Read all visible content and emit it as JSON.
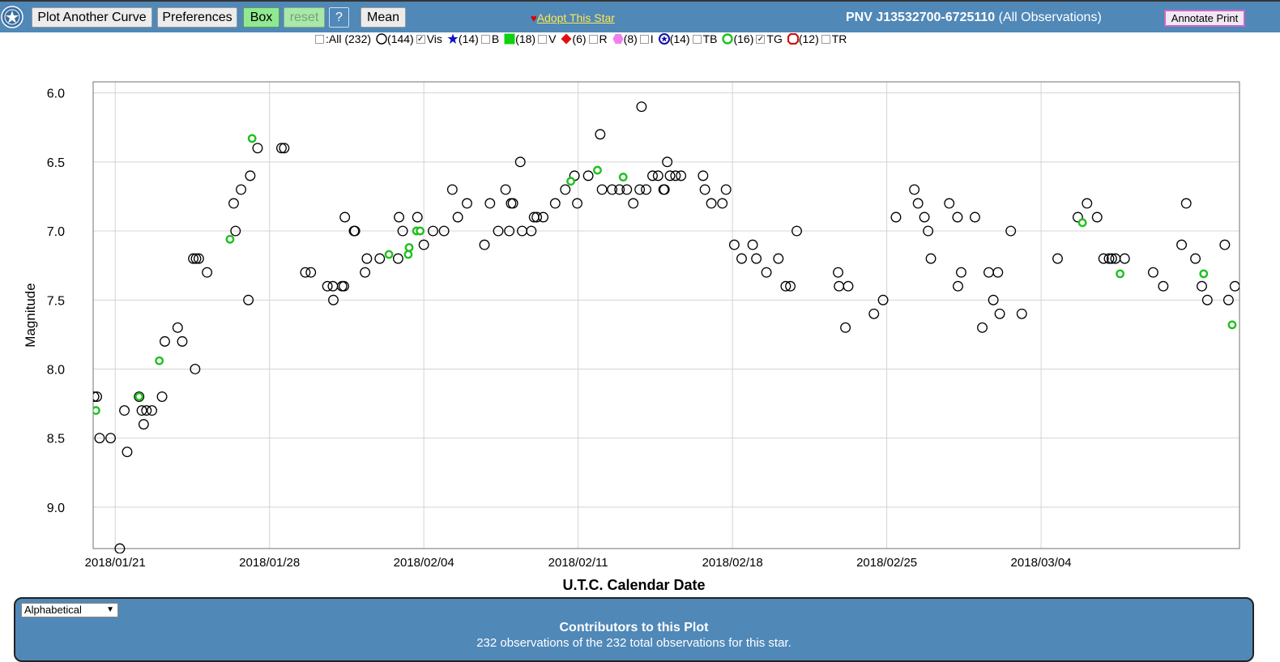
{
  "toolbar": {
    "plot_another": "Plot Another Curve",
    "preferences": "Preferences",
    "box": "Box",
    "reset": "reset",
    "help": "?",
    "mean": "Mean",
    "adopt_heart": "♥",
    "adopt_link": "Adopt This Star",
    "star_name": "PNV J13532700-6725110",
    "star_scope": "(All Observations)",
    "annotate": "Annotate Print"
  },
  "legend": [
    {
      "checkbox": false,
      "count": "",
      "label": ":All (232)",
      "icon": "none",
      "color": ""
    },
    {
      "checkbox": true,
      "count": "(144)",
      "label": "Vis",
      "icon": "open-circle-icon",
      "color": "#000000"
    },
    {
      "checkbox": false,
      "count": "(14)",
      "label": "B",
      "icon": "star-icon",
      "color": "#1010d0"
    },
    {
      "checkbox": false,
      "count": "(18)",
      "label": "V",
      "icon": "square-icon",
      "color": "#10d010"
    },
    {
      "checkbox": false,
      "count": "(6)",
      "label": "R",
      "icon": "diamond-icon",
      "color": "#e01010"
    },
    {
      "checkbox": false,
      "count": "(8)",
      "label": "I",
      "icon": "hexagon-icon",
      "color": "#f080f0"
    },
    {
      "checkbox": false,
      "count": "(14)",
      "label": "TB",
      "icon": "ring-star-icon",
      "color": "#1010a0"
    },
    {
      "checkbox": true,
      "count": "(16)",
      "label": "TG",
      "icon": "green-ring-icon",
      "color": "#20c020"
    },
    {
      "checkbox": false,
      "count": "(12)",
      "label": "TR",
      "icon": "red-octagon-icon",
      "color": "#d01010"
    }
  ],
  "chart_data": {
    "type": "scatter",
    "ylabel": "Magnitude",
    "xlabel": "U.T.C. Calendar Date",
    "x_unit": "date (UTC)",
    "xlim": [
      "2018-01-20T00:00",
      "2018-03-13T00:00"
    ],
    "ylim": [
      5.92,
      9.3
    ],
    "y_inverted": true,
    "y_ticks": [
      "6.0",
      "6.5",
      "7.0",
      "7.5",
      "8.0",
      "8.5",
      "9.0"
    ],
    "x_ticks": [
      {
        "date": "2018-01-21",
        "label": "2018/01/21"
      },
      {
        "date": "2018-01-28",
        "label": "2018/01/28"
      },
      {
        "date": "2018-02-04",
        "label": "2018/02/04"
      },
      {
        "date": "2018-02-11",
        "label": "2018/02/11"
      },
      {
        "date": "2018-02-18",
        "label": "2018/02/18"
      },
      {
        "date": "2018-02-25",
        "label": "2018/02/25"
      },
      {
        "date": "2018-03-04",
        "label": "2018/03/04"
      }
    ],
    "grid": true,
    "series": [
      {
        "name": "Vis",
        "marker": "open-circle",
        "color": "#000000",
        "points": [
          {
            "x": "2018-01-20T01:00",
            "y": 8.2
          },
          {
            "x": "2018-01-20T04:00",
            "y": 8.2
          },
          {
            "x": "2018-01-20T07:00",
            "y": 8.5
          },
          {
            "x": "2018-01-20T19:00",
            "y": 8.5
          },
          {
            "x": "2018-01-21T05:00",
            "y": 9.3
          },
          {
            "x": "2018-01-21T10:00",
            "y": 8.3
          },
          {
            "x": "2018-01-21T13:00",
            "y": 8.6
          },
          {
            "x": "2018-01-22T02:00",
            "y": 8.2
          },
          {
            "x": "2018-01-22T05:00",
            "y": 8.3
          },
          {
            "x": "2018-01-22T07:00",
            "y": 8.4
          },
          {
            "x": "2018-01-22T10:00",
            "y": 8.3
          },
          {
            "x": "2018-01-22T16:00",
            "y": 8.3
          },
          {
            "x": "2018-01-23T03:00",
            "y": 8.2
          },
          {
            "x": "2018-01-23T06:00",
            "y": 7.8
          },
          {
            "x": "2018-01-23T20:00",
            "y": 7.7
          },
          {
            "x": "2018-01-24T01:00",
            "y": 7.8
          },
          {
            "x": "2018-01-24T13:00",
            "y": 7.2
          },
          {
            "x": "2018-01-24T15:00",
            "y": 8.0
          },
          {
            "x": "2018-01-24T16:00",
            "y": 7.2
          },
          {
            "x": "2018-01-24T19:00",
            "y": 7.2
          },
          {
            "x": "2018-01-25T04:00",
            "y": 7.3
          },
          {
            "x": "2018-01-26T09:00",
            "y": 6.8
          },
          {
            "x": "2018-01-26T11:00",
            "y": 7.0
          },
          {
            "x": "2018-01-26T17:00",
            "y": 6.7
          },
          {
            "x": "2018-01-27T01:00",
            "y": 7.5
          },
          {
            "x": "2018-01-27T03:00",
            "y": 6.6
          },
          {
            "x": "2018-01-27T11:00",
            "y": 6.4
          },
          {
            "x": "2018-01-28T13:00",
            "y": 6.4
          },
          {
            "x": "2018-01-28T16:00",
            "y": 6.4
          },
          {
            "x": "2018-01-29T15:00",
            "y": 7.3
          },
          {
            "x": "2018-01-29T21:00",
            "y": 7.3
          },
          {
            "x": "2018-01-30T15:00",
            "y": 7.4
          },
          {
            "x": "2018-01-30T21:00",
            "y": 7.4
          },
          {
            "x": "2018-01-30T21:30",
            "y": 7.5
          },
          {
            "x": "2018-01-31T07:00",
            "y": 7.4
          },
          {
            "x": "2018-01-31T09:00",
            "y": 7.4
          },
          {
            "x": "2018-01-31T10:00",
            "y": 6.9
          },
          {
            "x": "2018-01-31T20:00",
            "y": 7.0
          },
          {
            "x": "2018-01-31T21:00",
            "y": 7.0
          },
          {
            "x": "2018-02-01T08:00",
            "y": 7.3
          },
          {
            "x": "2018-02-01T10:00",
            "y": 7.2
          },
          {
            "x": "2018-02-02T00:00",
            "y": 7.2
          },
          {
            "x": "2018-02-02T20:00",
            "y": 7.2
          },
          {
            "x": "2018-02-02T21:00",
            "y": 6.9
          },
          {
            "x": "2018-02-03T01:00",
            "y": 7.0
          },
          {
            "x": "2018-02-03T17:00",
            "y": 6.9
          },
          {
            "x": "2018-02-04T00:00",
            "y": 7.1
          },
          {
            "x": "2018-02-04T10:00",
            "y": 7.0
          },
          {
            "x": "2018-02-04T22:00",
            "y": 7.0
          },
          {
            "x": "2018-02-05T07:00",
            "y": 6.7
          },
          {
            "x": "2018-02-05T13:00",
            "y": 6.9
          },
          {
            "x": "2018-02-05T23:00",
            "y": 6.8
          },
          {
            "x": "2018-02-06T18:00",
            "y": 7.1
          },
          {
            "x": "2018-02-07T00:00",
            "y": 6.8
          },
          {
            "x": "2018-02-07T09:00",
            "y": 7.0
          },
          {
            "x": "2018-02-07T17:00",
            "y": 6.7
          },
          {
            "x": "2018-02-07T21:00",
            "y": 7.0
          },
          {
            "x": "2018-02-07T23:00",
            "y": 6.8
          },
          {
            "x": "2018-02-08T01:00",
            "y": 6.8
          },
          {
            "x": "2018-02-08T09:00",
            "y": 6.5
          },
          {
            "x": "2018-02-08T11:00",
            "y": 7.0
          },
          {
            "x": "2018-02-08T21:00",
            "y": 7.0
          },
          {
            "x": "2018-02-09T00:00",
            "y": 6.9
          },
          {
            "x": "2018-02-09T03:00",
            "y": 6.9
          },
          {
            "x": "2018-02-09T10:00",
            "y": 6.9
          },
          {
            "x": "2018-02-09T23:00",
            "y": 6.8
          },
          {
            "x": "2018-02-10T10:00",
            "y": 6.7
          },
          {
            "x": "2018-02-10T20:00",
            "y": 6.6
          },
          {
            "x": "2018-02-10T23:00",
            "y": 6.8
          },
          {
            "x": "2018-02-11T11:00",
            "y": 6.6
          },
          {
            "x": "2018-02-12T00:00",
            "y": 6.3
          },
          {
            "x": "2018-02-12T02:00",
            "y": 6.7
          },
          {
            "x": "2018-02-12T13:00",
            "y": 6.7
          },
          {
            "x": "2018-02-12T21:00",
            "y": 6.7
          },
          {
            "x": "2018-02-13T05:00",
            "y": 6.7
          },
          {
            "x": "2018-02-13T12:00",
            "y": 6.8
          },
          {
            "x": "2018-02-13T19:00",
            "y": 6.7
          },
          {
            "x": "2018-02-13T21:00",
            "y": 6.1
          },
          {
            "x": "2018-02-14T02:00",
            "y": 6.7
          },
          {
            "x": "2018-02-14T09:00",
            "y": 6.6
          },
          {
            "x": "2018-02-14T15:00",
            "y": 6.6
          },
          {
            "x": "2018-02-14T21:00",
            "y": 6.7
          },
          {
            "x": "2018-02-14T22:00",
            "y": 6.7
          },
          {
            "x": "2018-02-15T01:00",
            "y": 6.5
          },
          {
            "x": "2018-02-15T04:00",
            "y": 6.6
          },
          {
            "x": "2018-02-15T10:00",
            "y": 6.6
          },
          {
            "x": "2018-02-15T16:00",
            "y": 6.6
          },
          {
            "x": "2018-02-16T16:00",
            "y": 6.6
          },
          {
            "x": "2018-02-16T18:00",
            "y": 6.7
          },
          {
            "x": "2018-02-17T01:00",
            "y": 6.8
          },
          {
            "x": "2018-02-17T13:00",
            "y": 6.8
          },
          {
            "x": "2018-02-17T17:00",
            "y": 6.7
          },
          {
            "x": "2018-02-18T02:00",
            "y": 7.1
          },
          {
            "x": "2018-02-18T10:00",
            "y": 7.2
          },
          {
            "x": "2018-02-18T22:00",
            "y": 7.1
          },
          {
            "x": "2018-02-19T02:00",
            "y": 7.2
          },
          {
            "x": "2018-02-19T13:00",
            "y": 7.3
          },
          {
            "x": "2018-02-20T02:00",
            "y": 7.2
          },
          {
            "x": "2018-02-20T10:00",
            "y": 7.4
          },
          {
            "x": "2018-02-20T15:00",
            "y": 7.4
          },
          {
            "x": "2018-02-20T22:00",
            "y": 7.0
          },
          {
            "x": "2018-02-22T19:00",
            "y": 7.3
          },
          {
            "x": "2018-02-22T20:00",
            "y": 7.4
          },
          {
            "x": "2018-02-23T03:00",
            "y": 7.7
          },
          {
            "x": "2018-02-23T06:00",
            "y": 7.4
          },
          {
            "x": "2018-02-24T10:00",
            "y": 7.6
          },
          {
            "x": "2018-02-24T20:00",
            "y": 7.5
          },
          {
            "x": "2018-02-25T10:00",
            "y": 6.9
          },
          {
            "x": "2018-02-26T06:00",
            "y": 6.7
          },
          {
            "x": "2018-02-26T10:00",
            "y": 6.8
          },
          {
            "x": "2018-02-26T17:00",
            "y": 6.9
          },
          {
            "x": "2018-02-26T21:00",
            "y": 7.0
          },
          {
            "x": "2018-02-27T00:00",
            "y": 7.2
          },
          {
            "x": "2018-02-27T20:00",
            "y": 6.8
          },
          {
            "x": "2018-02-28T05:00",
            "y": 6.9
          },
          {
            "x": "2018-02-28T05:30",
            "y": 7.4
          },
          {
            "x": "2018-02-28T09:00",
            "y": 7.3
          },
          {
            "x": "2018-03-01T00:00",
            "y": 6.9
          },
          {
            "x": "2018-03-01T08:00",
            "y": 7.7
          },
          {
            "x": "2018-03-01T15:00",
            "y": 7.3
          },
          {
            "x": "2018-03-01T20:00",
            "y": 7.5
          },
          {
            "x": "2018-03-02T01:00",
            "y": 7.3
          },
          {
            "x": "2018-03-02T03:00",
            "y": 7.6
          },
          {
            "x": "2018-03-02T15:00",
            "y": 7.0
          },
          {
            "x": "2018-03-03T03:00",
            "y": 7.6
          },
          {
            "x": "2018-03-04T18:00",
            "y": 7.2
          },
          {
            "x": "2018-03-05T16:00",
            "y": 6.9
          },
          {
            "x": "2018-03-06T02:00",
            "y": 6.8
          },
          {
            "x": "2018-03-06T13:00",
            "y": 6.9
          },
          {
            "x": "2018-03-06T20:00",
            "y": 7.2
          },
          {
            "x": "2018-03-07T02:00",
            "y": 7.2
          },
          {
            "x": "2018-03-07T05:00",
            "y": 7.2
          },
          {
            "x": "2018-03-07T09:00",
            "y": 7.2
          },
          {
            "x": "2018-03-07T19:00",
            "y": 7.2
          },
          {
            "x": "2018-03-09T02:00",
            "y": 7.3
          },
          {
            "x": "2018-03-09T13:00",
            "y": 7.4
          },
          {
            "x": "2018-03-10T09:00",
            "y": 7.1
          },
          {
            "x": "2018-03-10T14:00",
            "y": 6.8
          },
          {
            "x": "2018-03-11T00:00",
            "y": 7.2
          },
          {
            "x": "2018-03-11T07:00",
            "y": 7.4
          },
          {
            "x": "2018-03-11T13:00",
            "y": 7.5
          },
          {
            "x": "2018-03-12T08:00",
            "y": 7.1
          },
          {
            "x": "2018-03-12T12:00",
            "y": 7.5
          },
          {
            "x": "2018-03-12T19:00",
            "y": 7.4
          }
        ]
      },
      {
        "name": "TG",
        "marker": "green-ring",
        "color": "#20c020",
        "points": [
          {
            "x": "2018-01-20T03:00",
            "y": 8.3
          },
          {
            "x": "2018-01-22T02:00",
            "y": 8.2
          },
          {
            "x": "2018-01-23T00:00",
            "y": 7.94
          },
          {
            "x": "2018-01-26T05:00",
            "y": 7.06
          },
          {
            "x": "2018-01-27T05:00",
            "y": 6.33
          },
          {
            "x": "2018-02-02T10:00",
            "y": 7.17
          },
          {
            "x": "2018-02-03T07:00",
            "y": 7.17
          },
          {
            "x": "2018-02-03T08:00",
            "y": 7.12
          },
          {
            "x": "2018-02-03T16:00",
            "y": 7.0
          },
          {
            "x": "2018-02-03T20:00",
            "y": 7.0
          },
          {
            "x": "2018-02-10T16:00",
            "y": 6.64
          },
          {
            "x": "2018-02-11T21:00",
            "y": 6.56
          },
          {
            "x": "2018-02-13T01:00",
            "y": 6.61
          },
          {
            "x": "2018-03-05T21:00",
            "y": 6.94
          },
          {
            "x": "2018-03-07T14:00",
            "y": 7.31
          },
          {
            "x": "2018-03-11T09:00",
            "y": 7.31
          },
          {
            "x": "2018-03-12T16:00",
            "y": 7.68
          }
        ]
      }
    ]
  },
  "bottom": {
    "sort_value": "Alphabetical",
    "contrib_title": "Contributors to this Plot",
    "contrib_sub": "232 observations of the 232 total observations for this star."
  }
}
